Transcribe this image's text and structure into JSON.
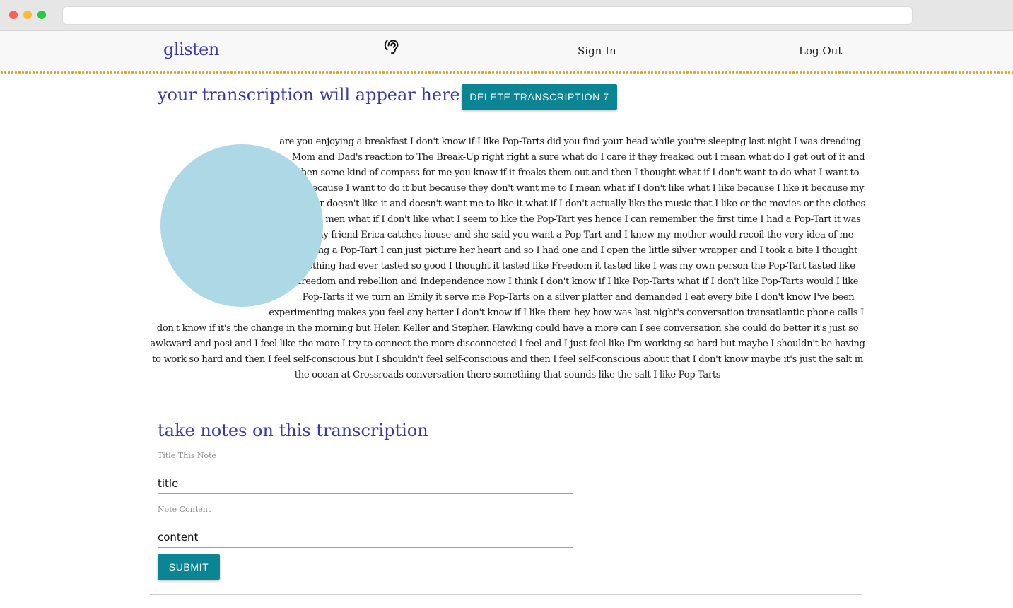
{
  "nav": {
    "brand": "glisten",
    "sign_in": "Sign In",
    "log_out": "Log Out",
    "icon": "hearing-icon"
  },
  "transcription": {
    "heading": "your transcription will appear here:",
    "delete_button": "DELETE TRANSCRIPTION 7",
    "text": "are you enjoying a breakfast I don't know if I like Pop-Tarts did you find your head while you're sleeping last night I was dreading Mom and Dad's reaction to The Break-Up right right a sure what do I care if they freaked out I mean what do I get out of it and then some kind of compass for me you know if it freaks them out and then I thought what if I don't want to do what I want to do because I want to do it but because they don't want me to I mean what if I don't like what I like because I like it because my mother doesn't like it and doesn't want me to like it what if I don't actually like the music that I like or the movies or the clothes or the men what if I don't like what I seem to like the Pop-Tart yes hence I can remember the first time I had a Pop-Tart it was at my friend Erica catches house and she said you want a Pop-Tart and I knew my mother would recoil the very idea of me having a Pop-Tart I can just picture her heart and so I had one and I open the little silver wrapper and I took a bite I thought nothing had ever tasted so good I thought it tasted like Freedom it tasted like I was my own person the Pop-Tart tasted like freedom and rebellion and Independence now I think I don't know if I like Pop-Tarts what if I don't like Pop-Tarts would I like Pop-Tarts if we turn an Emily it serve me Pop-Tarts on a silver platter and demanded I eat every bite I don't know I've been experimenting makes you feel any better I don't know if I like them hey how was last night's conversation transatlantic phone calls I don't know if it's the change in the morning but Helen Keller and Stephen Hawking could have a more can I see conversation she could do better it's just so awkward and posi and I feel like the more I try to connect the more disconnected I feel and I just feel like I'm working so hard but maybe I shouldn't be having to work so hard and then I feel self-conscious but I shouldn't feel self-conscious and then I feel self-conscious about that I don't know maybe it's just the salt in the ocean at Crossroads conversation there something that sounds like the salt I like Pop-Tarts",
    "circle_color": "#add8e6"
  },
  "notes": {
    "heading": "take notes on this transcription",
    "title_label": "Title This Note",
    "title_value": "title",
    "content_label": "Note Content",
    "content_value": "content",
    "submit_button": "SUBMIT"
  },
  "colors": {
    "accent_text": "#3a38a8",
    "button": "#0b8593",
    "navbar_border": "#d9a622"
  }
}
